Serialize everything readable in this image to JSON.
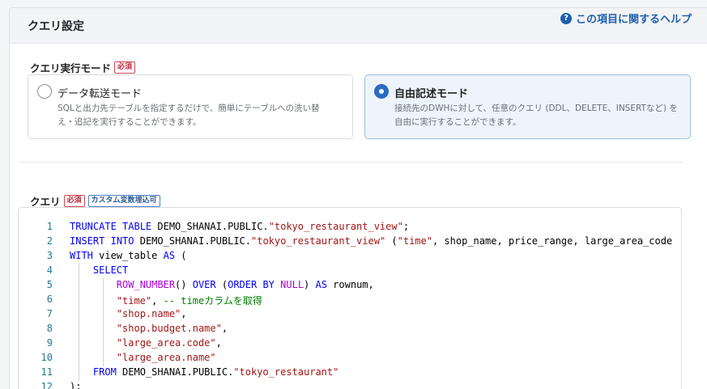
{
  "header": {
    "title": "クエリ設定",
    "help_icon": "?",
    "help_label": "この項目に関するヘルプ"
  },
  "mode_section": {
    "label": "クエリ実行モード",
    "required_badge": "必須",
    "options": [
      {
        "title": "データ転送モード",
        "desc_line1": "SQLと出力先テーブルを指定するだけで、簡単にテーブルへの洗い替",
        "desc_line2": "え・追記を実行することができます。",
        "selected": false
      },
      {
        "title": "自由記述モード",
        "desc_line1": "接続先のDWHに対して、任意のクエリ (DDL、DELETE、INSERTなど) を",
        "desc_line2": "自由に実行することができます。",
        "selected": true
      }
    ]
  },
  "query_section": {
    "label": "クエリ",
    "required_badge": "必須",
    "custom_var_badge": "カスタム変数埋込可"
  },
  "editor": {
    "line_numbers": [
      "1",
      "2",
      "3",
      "4",
      "5",
      "6",
      "7",
      "8",
      "9",
      "10",
      "11",
      "12"
    ],
    "lines": [
      "TRUNCATE TABLE DEMO_SHANAI.PUBLIC.\"tokyo_restaurant_view\";",
      "INSERT INTO DEMO_SHANAI.PUBLIC.\"tokyo_restaurant_view\" (\"time\", shop_name, price_range, large_area_code",
      "WITH view_table AS (",
      "    SELECT",
      "        ROW_NUMBER() OVER (ORDER BY NULL) AS rownum,",
      "        \"time\", -- timeカラムを取得",
      "        \"shop.name\",",
      "        \"shop.budget.name\",",
      "        \"large_area.code\",",
      "        \"large_area.name\"",
      "    FROM DEMO_SHANAI.PUBLIC.\"tokyo_restaurant\"",
      ");"
    ]
  },
  "colors": {
    "accent": "#2a6cc0",
    "help_link": "#1d5fb0",
    "required": "#c0273a",
    "keyword": "#0000ff",
    "string": "#a31515",
    "comment": "#008000",
    "function": "#af00db",
    "line_number": "#237893"
  }
}
